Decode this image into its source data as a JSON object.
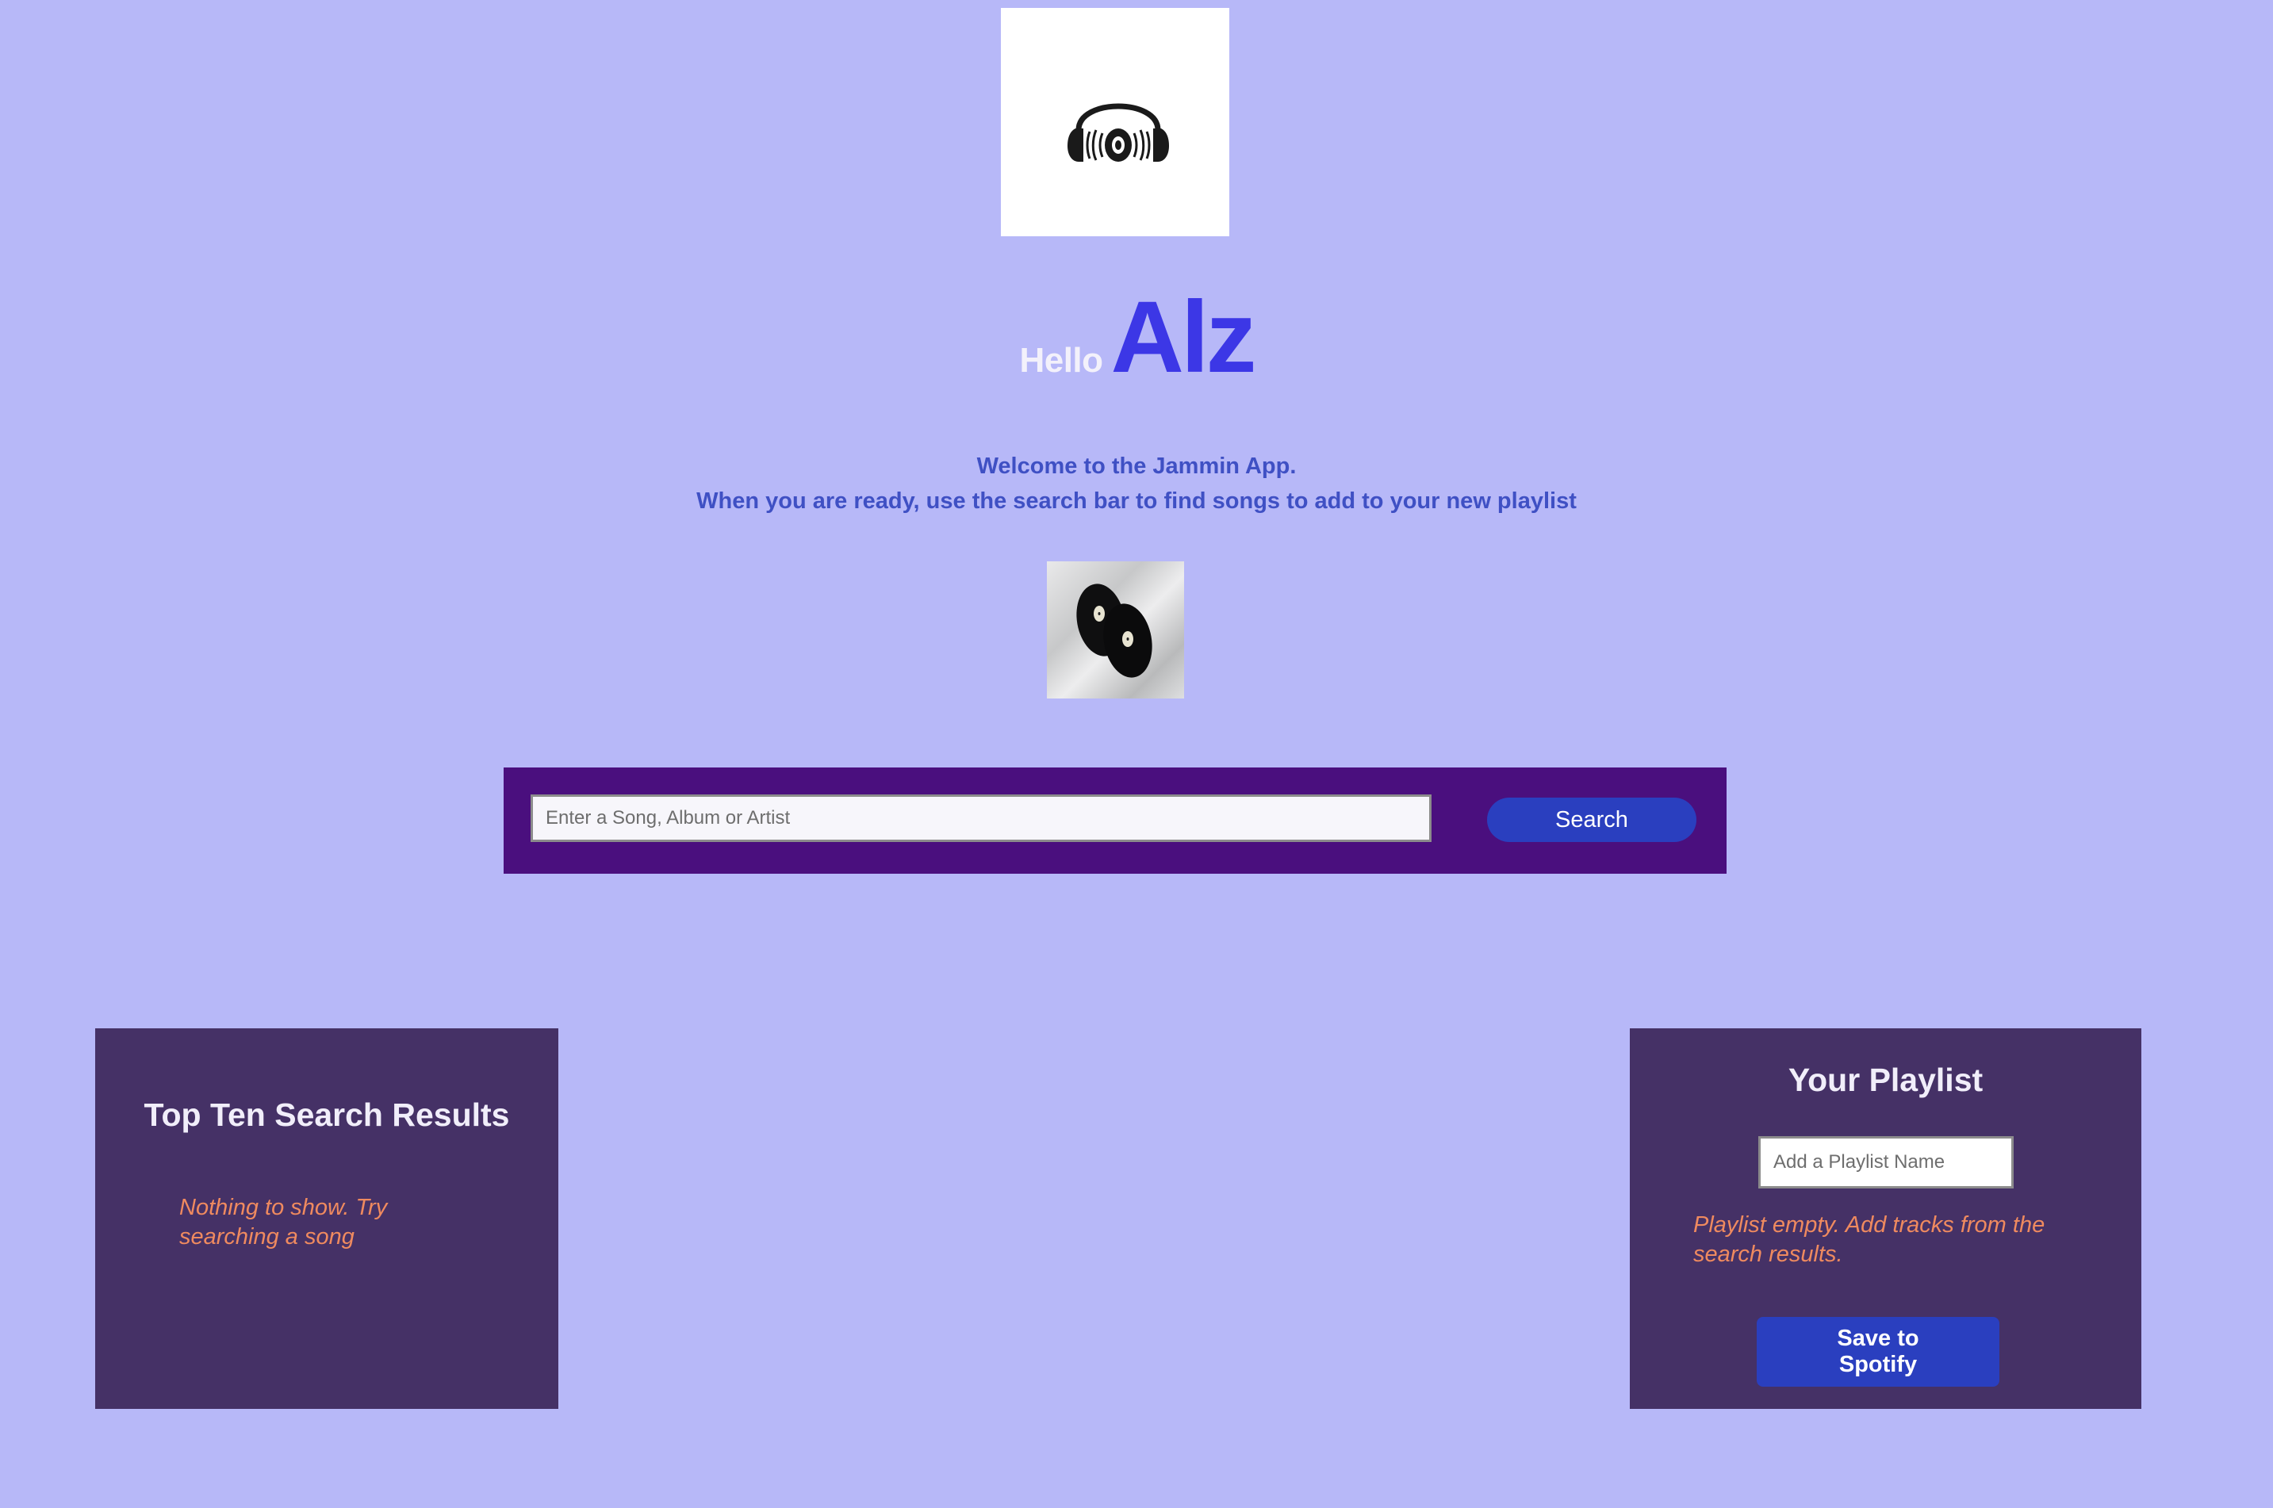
{
  "header": {
    "logo_icon": "headphones-vinyl-icon",
    "greeting": "Hello",
    "user_name": "Alz"
  },
  "welcome": {
    "line1": "Welcome to the Jammin App.",
    "line2": "When you are ready, use the search bar to find songs to add to your new playlist"
  },
  "hero_image": {
    "icon": "vinyl-records-image"
  },
  "search": {
    "placeholder": "Enter a Song, Album or Artist",
    "value": "",
    "button_label": "Search"
  },
  "results": {
    "title": "Top Ten Search Results",
    "empty_message": "Nothing to show. Try searching a song"
  },
  "playlist": {
    "title": "Your Playlist",
    "name_placeholder": "Add a Playlist Name",
    "name_value": "",
    "empty_message": "Playlist empty. Add tracks from the search results.",
    "save_label": "Save to Spotify"
  },
  "colors": {
    "background": "#b7b8f8",
    "accent": "#3c37e6",
    "panel": "#453166",
    "search_bar": "#4a0f7e",
    "button": "#2a3fbf",
    "empty_text": "#ef8a5f"
  }
}
